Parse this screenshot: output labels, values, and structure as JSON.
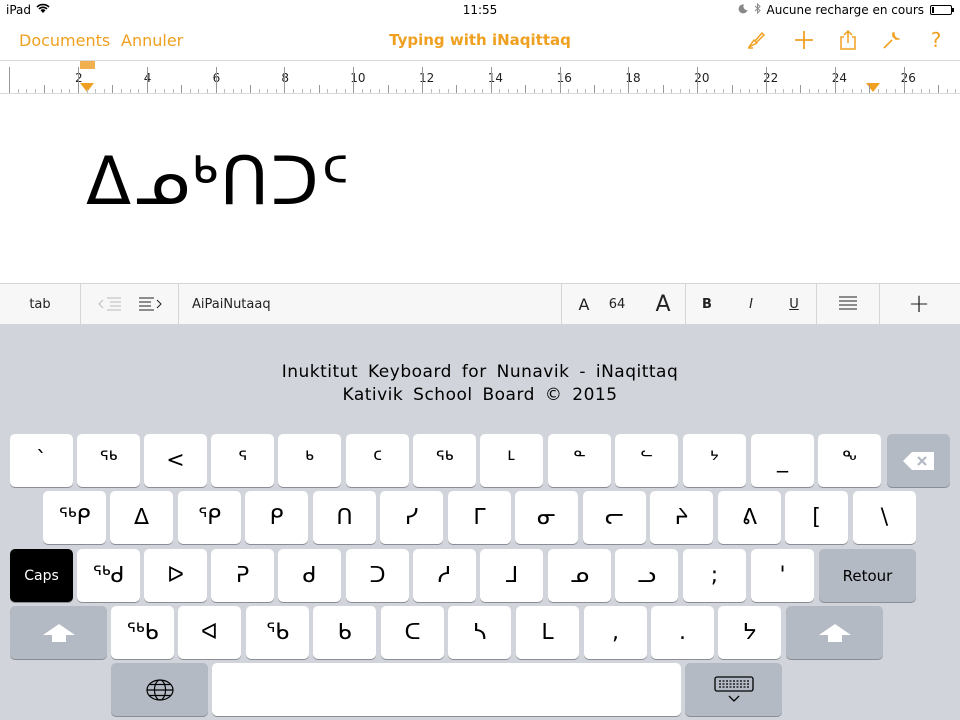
{
  "status": {
    "device": "iPad",
    "time": "11:55",
    "charging": "Aucune recharge en cours",
    "battery_level": 0.1
  },
  "nav": {
    "left_buttons": [
      "Documents",
      "Annuler"
    ],
    "title": "Typing with iNaqittaq",
    "icons": [
      "paintbrush-icon",
      "plus-icon",
      "share-icon",
      "wrench-icon",
      "help-icon"
    ],
    "help_label": "?",
    "accent": "#f0a020"
  },
  "ruler": {
    "numbers": [
      "2",
      "4",
      "6",
      "8",
      "10",
      "12",
      "14",
      "16",
      "18",
      "20",
      "22",
      "24",
      "26"
    ]
  },
  "document": {
    "text": "ᐃᓄᒃᑎᑐᑦ"
  },
  "format_bar": {
    "tab": "tab",
    "style_name": "AiPaiNutaaq",
    "font_small": "A",
    "font_size": "64",
    "font_large": "A",
    "bold": "B",
    "italic": "I",
    "underline": "U",
    "insert": "+"
  },
  "keyboard": {
    "credit_line1": "Inuktitut Keyboard for Nunavik - iNaqittaq",
    "credit_line2": "Kativik School Board © 2015",
    "row1": [
      "`",
      "ᖅ",
      "<",
      "ᕐ",
      "ᒃ",
      "ᑦ",
      "ᕐᒃ",
      "ᒻ",
      "ᓐ",
      "ᓪ",
      "ᔾ",
      "_",
      "ᖕ"
    ],
    "row2": [
      "ᖅᑭ",
      "ᐃ",
      "ᕿ",
      "ᑭ",
      "ᑎ",
      "ᓯ",
      "ᒥ",
      "ᓂ",
      "ᓕ",
      "ᔨ",
      "ᕕ",
      "[",
      "\\"
    ],
    "row3": [
      "ᖅᑯ",
      "ᐅ",
      "ᕈ",
      "ᑯ",
      "ᑐ",
      "ᓱ",
      "ᒧ",
      "ᓄ",
      "ᓗ",
      ";",
      "'"
    ],
    "row4": [
      "ᖅᑲ",
      "ᐊ",
      "ᖃ",
      "ᑲ",
      "ᑕ",
      "ᓴ",
      "ᒪ",
      ",",
      ".",
      "ᔭ"
    ],
    "caps": "Caps",
    "retour": "Retour"
  }
}
